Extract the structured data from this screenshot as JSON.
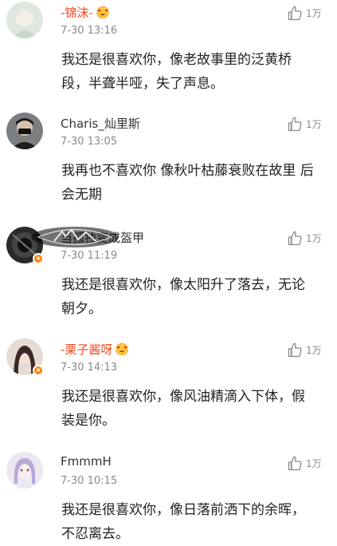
{
  "comments": [
    {
      "username": "-锦沫-",
      "time": "7-30 13:16",
      "likes": "1万",
      "text": "我还是很喜欢你，像老故事里的泛黄桥段，半聋半哑，失了声息。"
    },
    {
      "username": "Charis_灿里斯",
      "time": "7-30 13:05",
      "likes": "1万",
      "text": "我再也不喜欢你 像秋叶枯藤衰败在故里 后会无期"
    },
    {
      "username": "当孤独变成盔甲",
      "time": "7-30 11:19",
      "likes": "1万",
      "text": "我还是很喜欢你，像太阳升了落去，无论朝夕。"
    },
    {
      "username": "-栗子酱呀",
      "time": "7-30 14:13",
      "likes": "1万",
      "text": "我还是很喜欢你，像风油精滴入下体，假装是你。"
    },
    {
      "username": "FmmmH",
      "time": "7-30 10:15",
      "likes": "1万",
      "text": "我还是很喜欢你，像日落前洒下的余晖，不忍离去。"
    }
  ],
  "icons": {
    "like": "thumbs-up-icon",
    "vip": "heart-eyes-emoji-icon",
    "verified": "weibo-verified-icon"
  },
  "colors": {
    "vip_name": "#f04a1f",
    "badge": "#ff8200",
    "secondary": "#8a8a8a"
  }
}
